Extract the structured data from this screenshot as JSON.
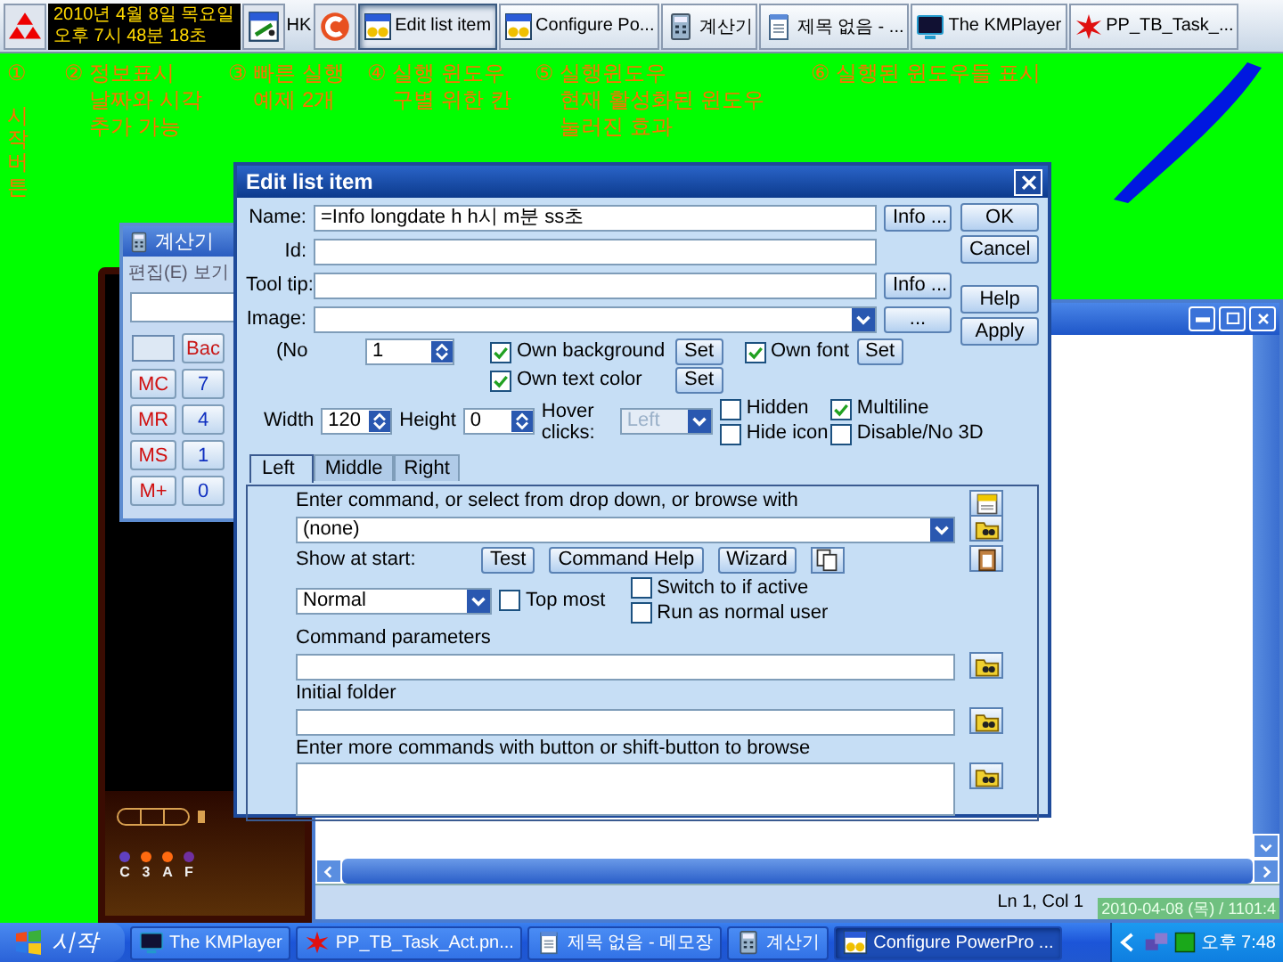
{
  "top_taskbar": {
    "clock_lines": [
      "2010년 4월 8일 목요일",
      "오후 7시 48분 18초"
    ],
    "quick_launch_label": "HK",
    "tasks": [
      {
        "label": "Edit list item",
        "kind": "config",
        "selected": true
      },
      {
        "label": "Configure Po...",
        "kind": "config",
        "selected": false
      },
      {
        "label": "계산기",
        "kind": "calculator",
        "selected": false
      },
      {
        "label": "제목 없음 - ...",
        "kind": "notepad",
        "selected": false
      },
      {
        "label": "The KMPlayer",
        "kind": "player",
        "selected": false
      },
      {
        "label": "PP_TB_Task_...",
        "kind": "paint",
        "selected": false
      }
    ]
  },
  "annotations": [
    {
      "marker": "①",
      "lines": [
        "시작버튼"
      ],
      "kind": "vertical"
    },
    {
      "marker": "②",
      "lines": [
        "정보표시",
        "날짜와 시각",
        "추가 가능"
      ],
      "kind": "block"
    },
    {
      "marker": "③",
      "lines": [
        "빠른 실행",
        "예제 2개"
      ],
      "kind": "block"
    },
    {
      "marker": "④",
      "lines": [
        "실행 윈도우",
        "구별 위한 칸"
      ],
      "kind": "block"
    },
    {
      "marker": "⑤",
      "lines": [
        "실행윈도우",
        "현재 활성화된 윈도우",
        "눌러진 효과"
      ],
      "kind": "block"
    },
    {
      "marker": "⑥",
      "lines": [
        "실행된 윈도우들 표시"
      ],
      "kind": "block"
    }
  ],
  "calculator": {
    "title": "계산기",
    "menu": [
      "편집(E)",
      "보기"
    ],
    "keys": [
      {
        "label": "Bac",
        "kind": "edit"
      },
      {
        "label": "MC",
        "kind": "memory"
      },
      {
        "label": "7",
        "kind": "digit"
      },
      {
        "label": "MR",
        "kind": "memory"
      },
      {
        "label": "4",
        "kind": "digit"
      },
      {
        "label": "MS",
        "kind": "memory"
      },
      {
        "label": "1",
        "kind": "digit"
      },
      {
        "label": "M+",
        "kind": "memory"
      },
      {
        "label": "0",
        "kind": "digit"
      }
    ]
  },
  "media_player": {
    "channel_labels": [
      "C",
      "3",
      "A",
      "F"
    ]
  },
  "notepad": {
    "status": "Ln 1, Col 1",
    "overlay_text": "2010-04-08 (목) / 1101:4"
  },
  "dialog": {
    "title": "Edit list item",
    "fields": [
      {
        "label": "Name:",
        "kind": "text",
        "value": "=Info longdate h h시 m분 ss초",
        "button": "Info ..."
      },
      {
        "label": "Id:",
        "kind": "text"
      },
      {
        "label": "Tool tip:",
        "kind": "text",
        "button": "Info ..."
      },
      {
        "label": "Image:",
        "kind": "combo",
        "button": "..."
      }
    ],
    "side_buttons": [
      "OK",
      "Cancel",
      "Help",
      "Apply"
    ],
    "number_label": "(No",
    "number_value": "1",
    "own_background": {
      "label": "Own background",
      "checked": true,
      "button": "Set"
    },
    "own_font": {
      "label": "Own font",
      "checked": true,
      "button": "Set"
    },
    "own_text_color": {
      "label": "Own text color",
      "checked": true,
      "button": "Set"
    },
    "width_label": "Width",
    "width_value": "120",
    "height_label": "Height",
    "height_value": "0",
    "hover_label": "Hover clicks:",
    "hover_value": "Left",
    "hover_disabled": true,
    "flags": [
      {
        "label": "Hidden",
        "checked": false
      },
      {
        "label": "Multiline",
        "checked": true
      },
      {
        "label": "Hide icon",
        "checked": false
      },
      {
        "label": "Disable/No 3D",
        "checked": false
      }
    ],
    "tabs": [
      {
        "label": "Left",
        "selected": true
      },
      {
        "label": "Middle",
        "selected": false
      },
      {
        "label": "Right",
        "selected": false
      }
    ],
    "command_label": "Enter command, or select from drop down, or browse with",
    "command_value": "(none)",
    "show_label": "Show at start:",
    "action_buttons": [
      "Test",
      "Command Help",
      "Wizard"
    ],
    "show_value": "Normal",
    "run_options": [
      {
        "label": "Top most",
        "checked": false
      },
      {
        "label": "Switch to if active",
        "checked": false
      },
      {
        "label": "Run as normal user",
        "checked": false
      }
    ],
    "params_label": "Command parameters",
    "folder_label": "Initial folder",
    "more_label": "Enter more commands with button or shift-button to browse"
  },
  "bottom_taskbar": {
    "start_label": "시작",
    "tasks": [
      {
        "label": "The KMPlayer",
        "kind": "player",
        "selected": false
      },
      {
        "label": "PP_TB_Task_Act.pn...",
        "kind": "paint",
        "selected": false
      },
      {
        "label": "제목 없음 - 메모장",
        "kind": "notepad",
        "selected": false
      },
      {
        "label": "계산기",
        "kind": "calculator",
        "selected": false
      },
      {
        "label": "Configure PowerPro ...",
        "kind": "config",
        "selected": true
      }
    ],
    "clock": "오후 7:48"
  }
}
